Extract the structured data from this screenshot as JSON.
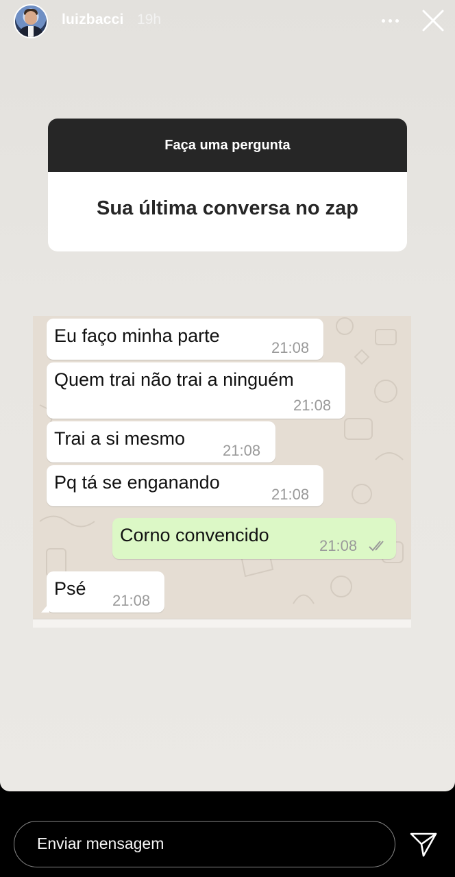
{
  "header": {
    "username": "luizbacci",
    "time": "19h"
  },
  "question": {
    "prompt": "Faça uma pergunta",
    "answer": "Sua última conversa no zap"
  },
  "chat": {
    "messages": [
      {
        "text": "Eu faço minha parte",
        "time": "21:08",
        "direction": "incoming"
      },
      {
        "text": "Quem trai não trai a ninguém",
        "time": "21:08",
        "direction": "incoming"
      },
      {
        "text": "Trai a si mesmo",
        "time": "21:08",
        "direction": "incoming"
      },
      {
        "text": "Pq tá se enganando",
        "time": "21:08",
        "direction": "incoming"
      },
      {
        "text": "Corno convencido",
        "time": "21:08",
        "direction": "outgoing"
      },
      {
        "text": "Psé",
        "time": "21:08",
        "direction": "incoming"
      }
    ]
  },
  "footer": {
    "reply_placeholder": "Enviar mensagem"
  },
  "icons": {
    "more": "more-horizontal-icon",
    "close": "close-icon",
    "send": "send-icon",
    "read_receipt": "double-check-icon"
  },
  "colors": {
    "sticker_header": "#262626",
    "incoming_bubble": "#ffffff",
    "outgoing_bubble": "#dcf8c6",
    "chat_background": "#e5ddd3"
  }
}
